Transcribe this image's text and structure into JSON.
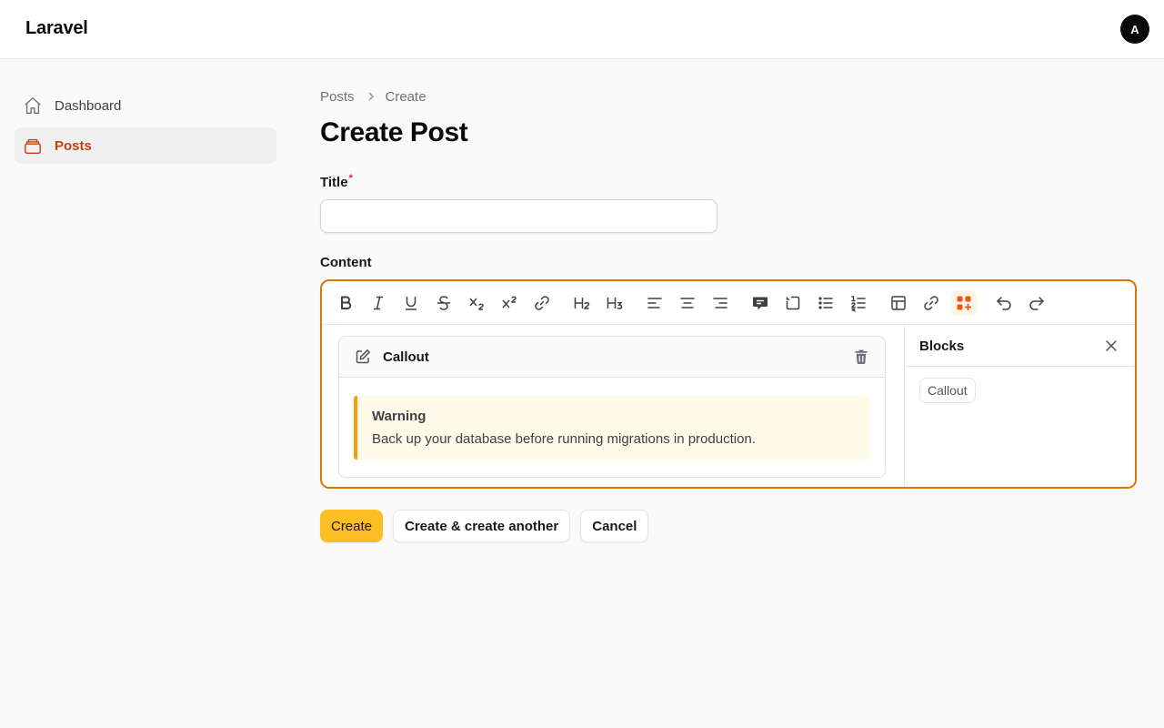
{
  "app": {
    "brand": "Laravel",
    "avatar_initial": "A"
  },
  "sidebar": {
    "items": [
      {
        "label": "Dashboard",
        "icon": "home-icon",
        "active": false
      },
      {
        "label": "Posts",
        "icon": "stack-icon",
        "active": true
      }
    ]
  },
  "breadcrumb": {
    "items": [
      "Posts",
      "Create"
    ]
  },
  "page": {
    "title": "Create Post"
  },
  "form": {
    "title_field": {
      "label": "Title",
      "required_mark": "*",
      "value": "",
      "placeholder": ""
    },
    "content_field": {
      "label": "Content"
    }
  },
  "editor": {
    "toolbar": [
      "bold-icon",
      "italic-icon",
      "underline-icon",
      "strikethrough-icon",
      "subscript-icon",
      "superscript-icon",
      "link-icon",
      "heading2-icon",
      "heading3-icon",
      "align-left-icon",
      "align-center-icon",
      "align-right-icon",
      "comment-icon",
      "hard-break-icon",
      "bullet-list-icon",
      "ordered-list-icon",
      "table-icon",
      "link-icon",
      "blocks-icon",
      "undo-icon",
      "redo-icon"
    ],
    "active_tool": "blocks-icon",
    "block": {
      "name": "Callout",
      "callout_title": "Warning",
      "callout_body": "Back up your database before running migrations in production."
    },
    "blocks_panel": {
      "title": "Blocks",
      "items": [
        "Callout"
      ]
    }
  },
  "actions": {
    "create": "Create",
    "create_another": "Create & create another",
    "cancel": "Cancel"
  },
  "colors": {
    "accent": "#d97706",
    "primary_button": "#fbbf24",
    "active_nav": "#c2410c",
    "callout_border": "#f59e0b",
    "callout_bg": "#fefbe8"
  }
}
